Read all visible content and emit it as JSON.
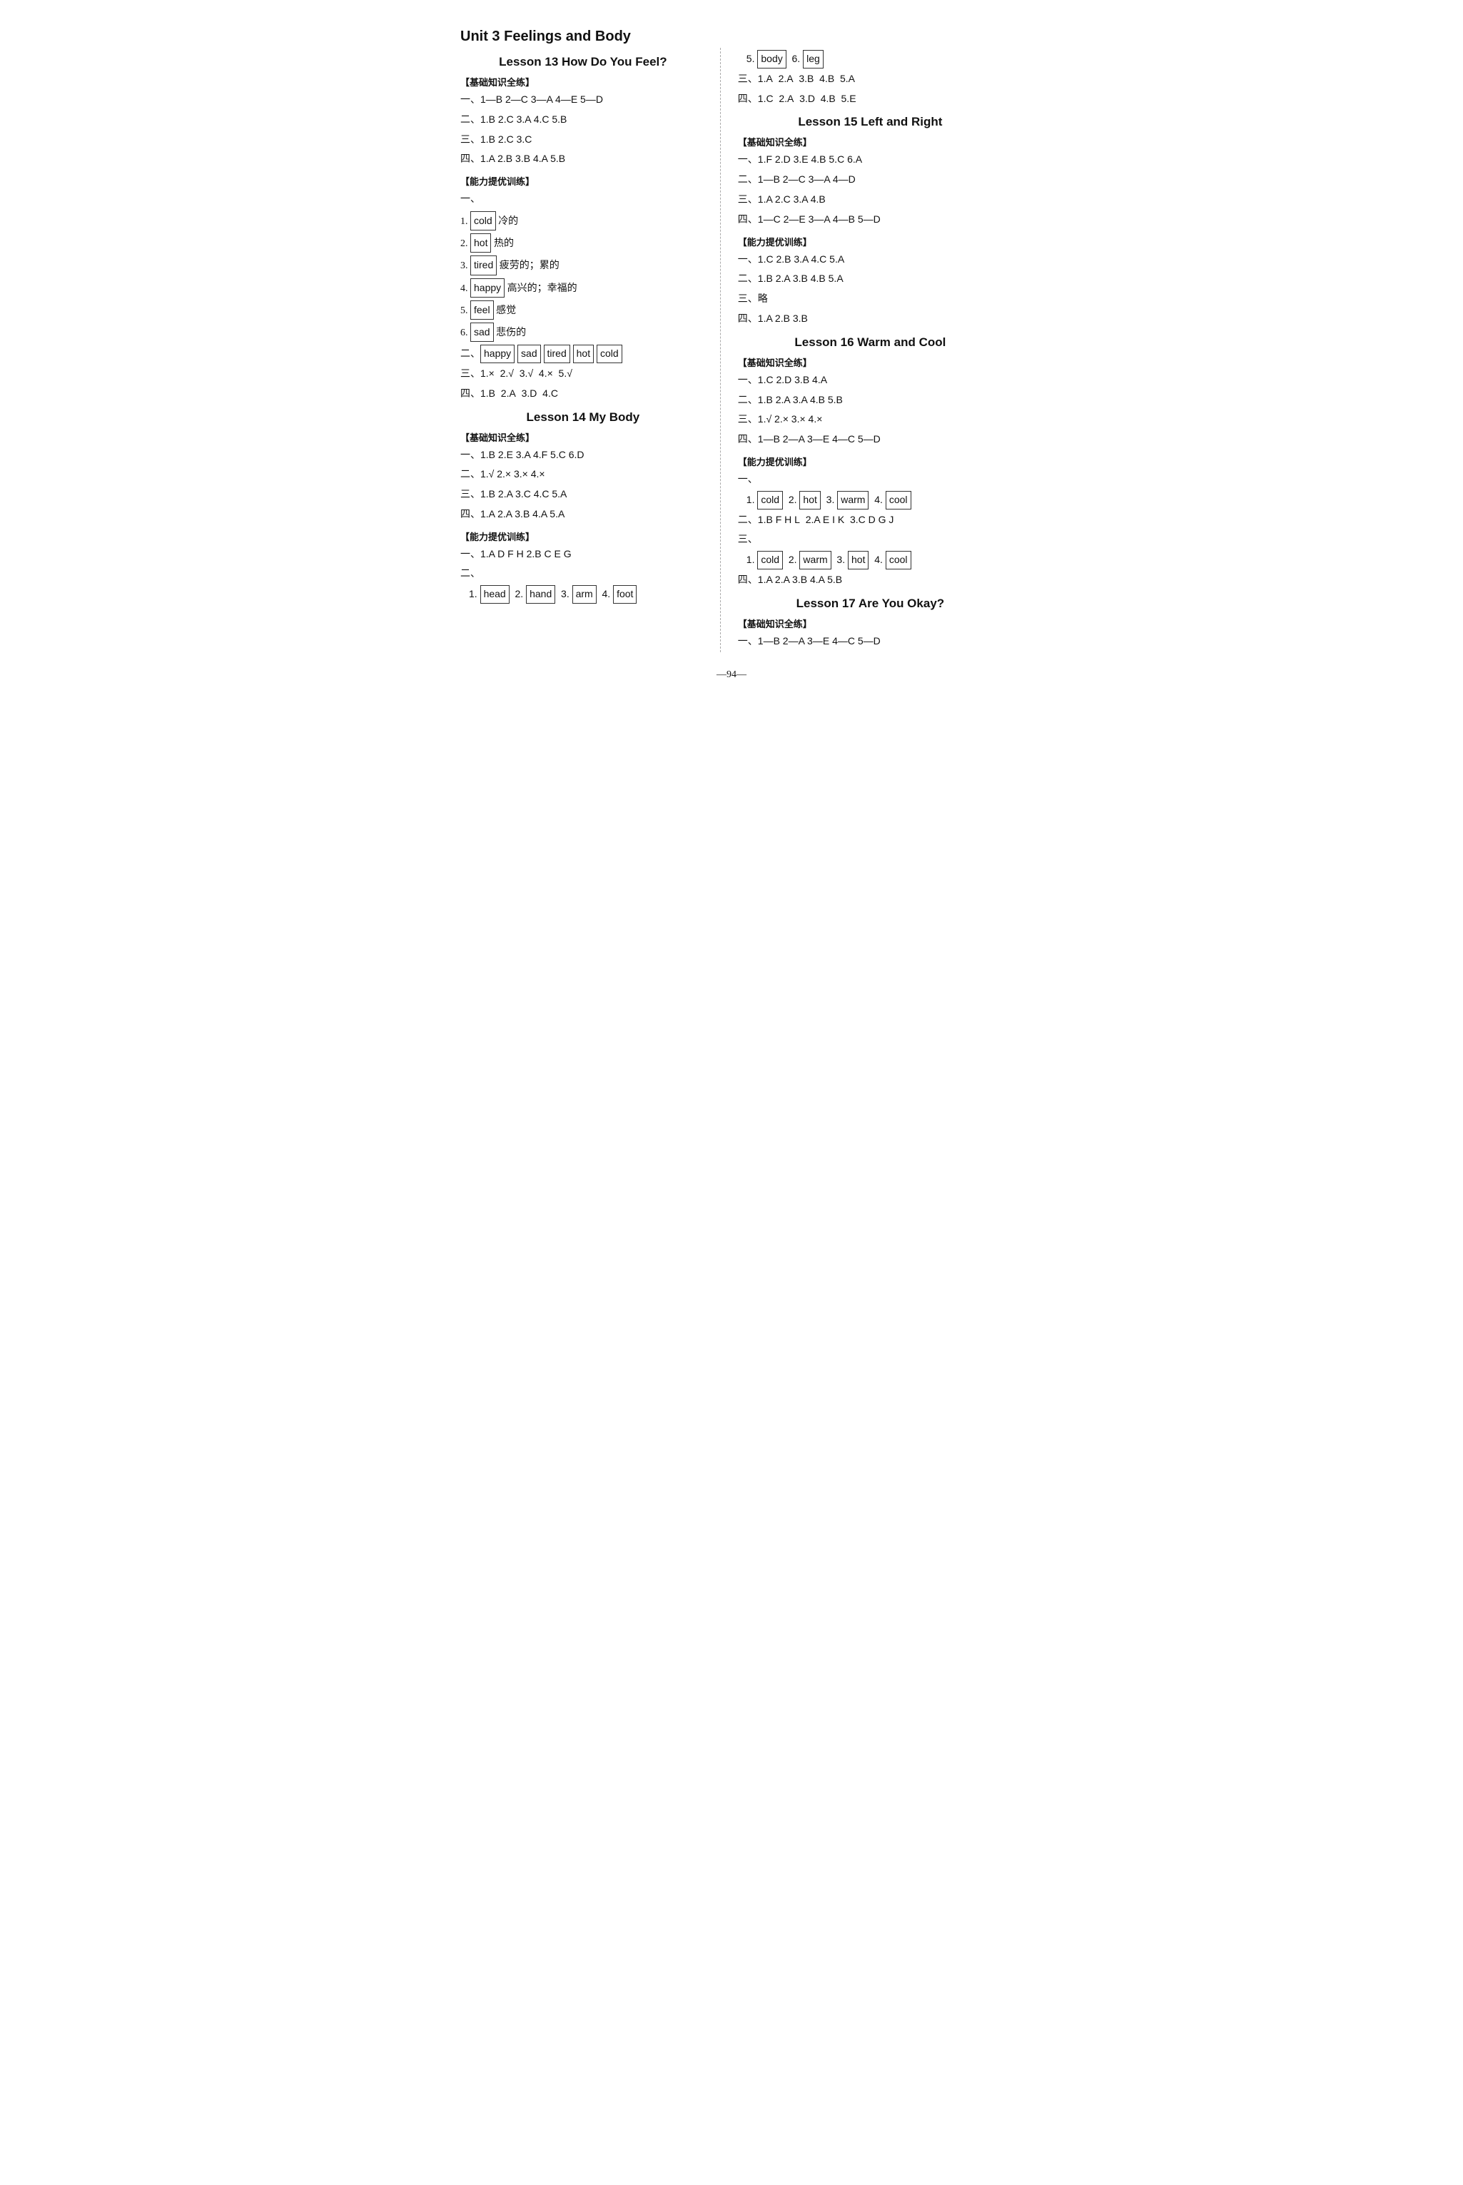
{
  "page": {
    "number": "—94—",
    "unit_title": "Unit 3  Feelings and Body",
    "left_column": {
      "lesson13": {
        "title": "Lesson 13  How Do You Feel?",
        "jichuTag": "【基础知识全练】",
        "sections": [
          {
            "label": "一、",
            "content": "1—B  2—C  3—A  4—E  5—D"
          },
          {
            "label": "二、",
            "content": "1.B  2.C  3.A  4.C  5.B"
          },
          {
            "label": "三、",
            "content": "1.B  2.C  3.C"
          },
          {
            "label": "四、",
            "content": "1.A  2.B  3.B  4.A  5.B"
          }
        ],
        "nenglTag": "【能力提优训练】",
        "vocab_label": "一、",
        "vocab": [
          {
            "num": "1.",
            "word": "cold",
            "cn": "冷的"
          },
          {
            "num": "2.",
            "word": "hot",
            "cn": "热的"
          },
          {
            "num": "3.",
            "word": "tired",
            "cn": "疲劳的；累的"
          },
          {
            "num": "4.",
            "word": "happy",
            "cn": "高兴的；幸福的"
          },
          {
            "num": "5.",
            "word": "feel",
            "cn": "感觉"
          },
          {
            "num": "6.",
            "word": "sad",
            "cn": "悲伤的"
          }
        ],
        "er_label": "二、",
        "er_content": "happy  sad  tired  hot  cold",
        "san_label": "三、",
        "san_content": "1.×  2.√  3.√  4.×  5.√",
        "si_label": "四、",
        "si_content": "1.B  2.A  3.D  4.C"
      },
      "lesson14": {
        "title": "Lesson 14  My Body",
        "jichuTag": "【基础知识全练】",
        "sections": [
          {
            "label": "一、",
            "content": "1.B  2.E  3.A  4.F  5.C  6.D"
          },
          {
            "label": "二、",
            "content": "1.√  2.×  3.×  4.×"
          },
          {
            "label": "三、",
            "content": "1.B  2.A  3.C  4.C  5.A"
          },
          {
            "label": "四、",
            "content": "1.A  2.A  3.B  4.A  5.A"
          }
        ],
        "nenglTag": "【能力提优训练】",
        "yi_label": "一、",
        "yi_content": "1.A D F H  2.B C E G",
        "er_label": "二、",
        "er_vocab": [
          {
            "num": "1.",
            "word": "head"
          },
          {
            "num": "2.",
            "word": "hand"
          },
          {
            "num": "3.",
            "word": "arm"
          },
          {
            "num": "4.",
            "word": "foot"
          }
        ]
      }
    },
    "right_column": {
      "lesson14_continued": {
        "items": [
          {
            "num": "5.",
            "word": "body"
          },
          {
            "num": "6.",
            "word": "leg"
          }
        ],
        "san_label": "三、",
        "san_content": "1.A  2.A  3.B  4.B  5.A",
        "si_label": "四、",
        "si_content": "1.C  2.A  3.D  4.B  5.E"
      },
      "lesson15": {
        "title": "Lesson 15  Left and Right",
        "jichuTag": "【基础知识全练】",
        "sections": [
          {
            "label": "一、",
            "content": "1.F  2.D  3.E  4.B  5.C  6.A"
          },
          {
            "label": "二、",
            "content": "1—B  2—C  3—A  4—D"
          },
          {
            "label": "三、",
            "content": "1.A  2.C  3.A  4.B"
          },
          {
            "label": "四、",
            "content": "1—C  2—E  3—A  4—B  5—D"
          }
        ],
        "nenglTag": "【能力提优训练】",
        "neng_sections": [
          {
            "label": "一、",
            "content": "1.C  2.B  3.A  4.C  5.A"
          },
          {
            "label": "二、",
            "content": "1.B  2.A  3.B  4.B  5.A"
          },
          {
            "label": "三、",
            "content": "略"
          },
          {
            "label": "四、",
            "content": "1.A  2.B  3.B"
          }
        ]
      },
      "lesson16": {
        "title": "Lesson 16  Warm and Cool",
        "jichuTag": "【基础知识全练】",
        "sections": [
          {
            "label": "一、",
            "content": "1.C  2.D  3.B  4.A"
          },
          {
            "label": "二、",
            "content": "1.B  2.A  3.A  4.B  5.B"
          },
          {
            "label": "三、",
            "content": "1.√  2.×  3.×  4.×"
          },
          {
            "label": "四、",
            "content": "1—B  2—A  3—E  4—C  5—D"
          }
        ],
        "nenglTag": "【能力提优训练】",
        "yi_label": "一、",
        "yi_vocab": [
          {
            "num": "1.",
            "word": "cold"
          },
          {
            "num": "2.",
            "word": "hot"
          },
          {
            "num": "3.",
            "word": "warm"
          },
          {
            "num": "4.",
            "word": "cool"
          }
        ],
        "er_label": "二、",
        "er_content": "1.B F H L  2.A E I K  3.C D G J",
        "san_label": "三、",
        "san_vocab": [
          {
            "num": "1.",
            "word": "cold"
          },
          {
            "num": "2.",
            "word": "warm"
          },
          {
            "num": "3.",
            "word": "hot"
          },
          {
            "num": "4.",
            "word": "cool"
          }
        ],
        "si_label": "四、",
        "si_content": "1.A  2.A  3.B  4.A  5.B"
      },
      "lesson17": {
        "title": "Lesson 17  Are You Okay?",
        "jichuTag": "【基础知识全练】",
        "yi_label": "一、",
        "yi_content": "1—B  2—A  3—E  4—C  5—D"
      }
    }
  }
}
